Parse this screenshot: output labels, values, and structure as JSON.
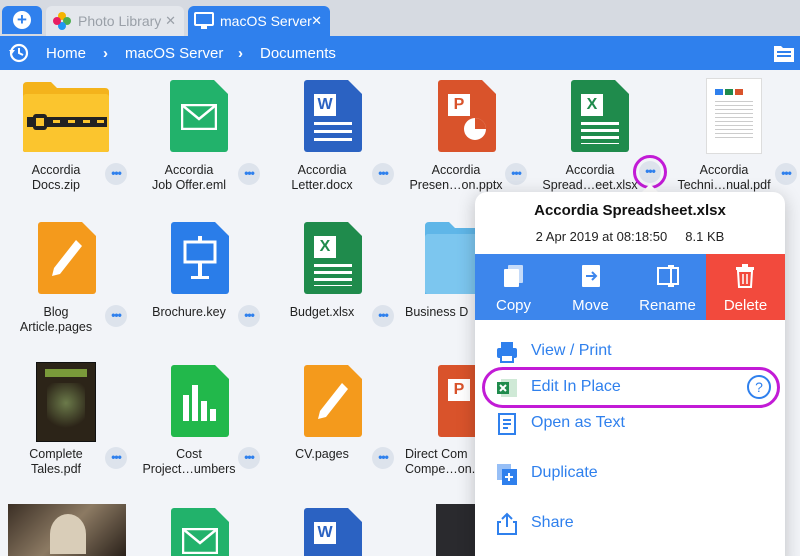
{
  "tabs": {
    "add_icon": "plus-icon",
    "photos_label": "Photo Library",
    "server_label": "macOS Server",
    "close_glyph": "✕"
  },
  "breadcrumb": {
    "home": "Home",
    "server": "macOS Server",
    "documents": "Documents",
    "separator": "›"
  },
  "files": {
    "row1": [
      {
        "line1": "Accordia",
        "line2": "Docs.zip"
      },
      {
        "line1": "Accordia",
        "line2": "Job Offer.eml"
      },
      {
        "line1": "Accordia",
        "line2": "Letter.docx"
      },
      {
        "line1": "Accordia",
        "line2": "Presen…on.pptx"
      },
      {
        "line1": "Accordia",
        "line2": "Spread…eet.xlsx"
      },
      {
        "line1": "Accordia",
        "line2": "Techni…nual.pdf"
      }
    ],
    "row2": [
      {
        "line1": "Blog",
        "line2": "Article.pages"
      },
      {
        "line1": "Brochure.key",
        "line2": ""
      },
      {
        "line1": "Budget.xlsx",
        "line2": ""
      },
      {
        "line1": "Business D",
        "line2": ""
      }
    ],
    "row3": [
      {
        "line1": "Complete",
        "line2": "Tales.pdf"
      },
      {
        "line1": "Cost",
        "line2": "Project…umbers"
      },
      {
        "line1": "CV.pages",
        "line2": ""
      },
      {
        "line1": "Direct Com",
        "line2": "Compe…on.pptx"
      }
    ],
    "dots": "•••"
  },
  "icon_letters": {
    "word": "W",
    "powerpoint": "P",
    "excel": "X"
  },
  "popover": {
    "title": "Accordia Spreadsheet.xlsx",
    "date": "2 Apr 2019 at 08:18:50",
    "size": "8.1 KB",
    "actions": {
      "copy": "Copy",
      "move": "Move",
      "rename": "Rename",
      "delete": "Delete"
    },
    "rows": {
      "view_print": "View / Print",
      "edit_in_place": "Edit In Place",
      "open_as_text": "Open as Text",
      "duplicate": "Duplicate",
      "share": "Share"
    },
    "help_glyph": "?"
  },
  "colors": {
    "accent": "#2f80ed",
    "delete": "#f24a3d",
    "highlight": "#c21bd6"
  }
}
